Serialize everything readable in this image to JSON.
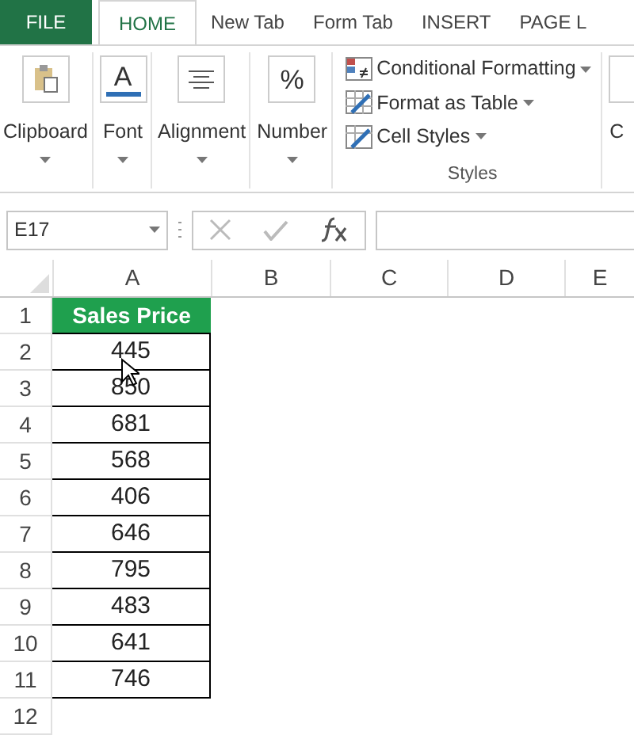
{
  "file_tab": {
    "label": "FILE"
  },
  "tabs": [
    {
      "label": "HOME",
      "selected": true
    },
    {
      "label": "New Tab",
      "selected": false
    },
    {
      "label": "Form Tab",
      "selected": false
    },
    {
      "label": "INSERT",
      "selected": false
    },
    {
      "label": "PAGE L",
      "selected": false
    }
  ],
  "ribbon": {
    "groups": [
      {
        "label": "Clipboard",
        "kind": "clipboard"
      },
      {
        "label": "Font",
        "kind": "font",
        "glyph": "A"
      },
      {
        "label": "Alignment",
        "kind": "alignment"
      },
      {
        "label": "Number",
        "kind": "number",
        "glyph": "%"
      }
    ],
    "styles": {
      "items": [
        {
          "label": "Conditional Formatting",
          "kind": "conditional"
        },
        {
          "label": "Format as Table",
          "kind": "table"
        },
        {
          "label": "Cell Styles",
          "kind": "cellstyles"
        }
      ],
      "label": "Styles"
    },
    "cut_group": {
      "label": "C"
    }
  },
  "name_box": "E17",
  "columns": [
    "A",
    "B",
    "C",
    "D",
    "E"
  ],
  "rows": [
    {
      "number": "1",
      "cell": "Sales Price",
      "kind": "header"
    },
    {
      "number": "2",
      "cell": "445",
      "kind": "value"
    },
    {
      "number": "3",
      "cell": "850",
      "kind": "value"
    },
    {
      "number": "4",
      "cell": "681",
      "kind": "value"
    },
    {
      "number": "5",
      "cell": "568",
      "kind": "value"
    },
    {
      "number": "6",
      "cell": "406",
      "kind": "value"
    },
    {
      "number": "7",
      "cell": "646",
      "kind": "value"
    },
    {
      "number": "8",
      "cell": "795",
      "kind": "value"
    },
    {
      "number": "9",
      "cell": "483",
      "kind": "value"
    },
    {
      "number": "10",
      "cell": "641",
      "kind": "value"
    },
    {
      "number": "11",
      "cell": "746",
      "kind": "value"
    },
    {
      "number": "12",
      "kind": "empty"
    }
  ]
}
